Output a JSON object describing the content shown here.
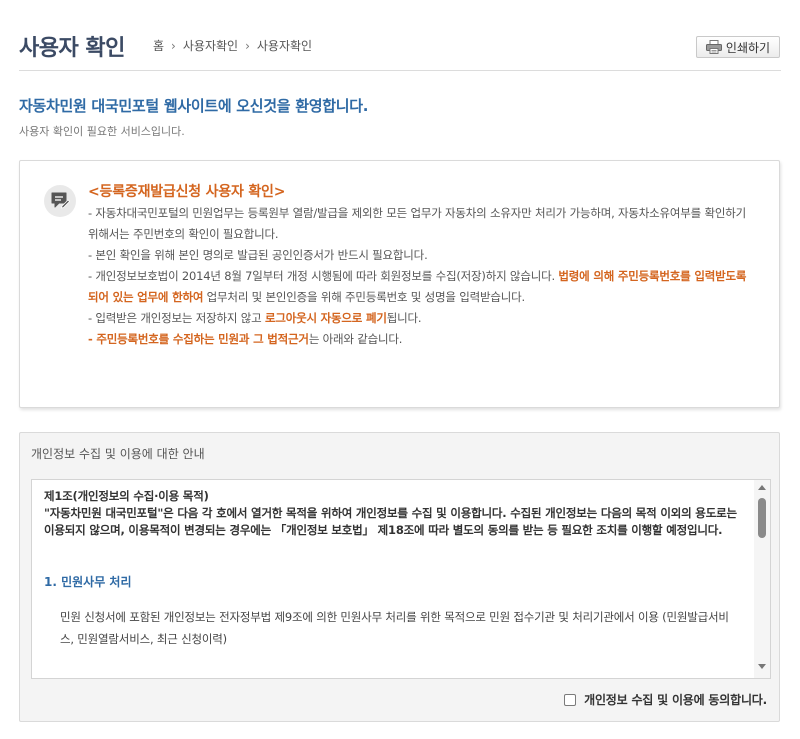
{
  "header": {
    "title": "사용자 확인",
    "breadcrumb": [
      "홈",
      "사용자확인",
      "사용자확인"
    ],
    "print_label": "인쇄하기"
  },
  "welcome": {
    "title": "자동차민원 대국민포털 웹사이트에 오신것을 환영합니다.",
    "subtitle": "사용자 확인이 필요한 서비스입니다."
  },
  "notice": {
    "title": "<등록증재발급신청 사용자 확인>",
    "line1": "- 자동차대국민포털의 민원업무는 등록원부 열람/발급을 제외한 모든 업무가 자동차의 소유자만 처리가 가능하며, 자동차소유여부를 확인하기 위해서는 주민번호의 확인이 필요합니다.",
    "line2": "- 본인 확인을 위해 본인 명의로 발급된 공인인증서가 반드시 필요합니다.",
    "line3_a": "- 개인정보보호법이 2014년 8월 7일부터 개정 시행됨에 따라 회원정보를 수집(저장)하지 않습니다. ",
    "line3_hl": "법령에 의해 주민등록번호를 입력받도록 되어 있는 업무에 한하여",
    "line3_b": " 업무처리 및 본인인증을 위해 주민등록번호 및 성명을 입력받습니다.",
    "line4_a": "- 입력받은 개인정보는 저장하지 않고 ",
    "line4_hl": "로그아웃시 자동으로 폐기",
    "line4_b": "됩니다.",
    "line5_hl": "- 주민등록번호를 수집하는 민원과 그 법적근거",
    "line5_b": "는 아래와 같습니다."
  },
  "privacy": {
    "label": "개인정보 수집 및 이용에 대한 안내",
    "article_title": "제1조(개인정보의 수집·이용 목적)",
    "article_body": "\"자동차민원 대국민포털\"은 다음 각 호에서 열거한 목적을 위하여 개인정보를 수집 및 이용합니다. 수집된 개인정보는 다음의 목적 이외의 용도로는 이용되지 않으며, 이용목적이 변경되는 경우에는 「개인정보 보호법」 제18조에 따라 별도의 동의를 받는 등 필요한 조치를 이행할 예정입니다.",
    "section_title": "1. 민원사무 처리",
    "section_body": "민원 신청서에 포함된 개인정보는 전자정부법 제9조에 의한 민원사무 처리를 위한 목적으로 민원 접수기관 및 처리기관에서 이용 (민원발급서비스, 민원열람서비스, 최근 신청이력)",
    "agree_label": "개인정보 수집 및 이용에 동의합니다."
  }
}
